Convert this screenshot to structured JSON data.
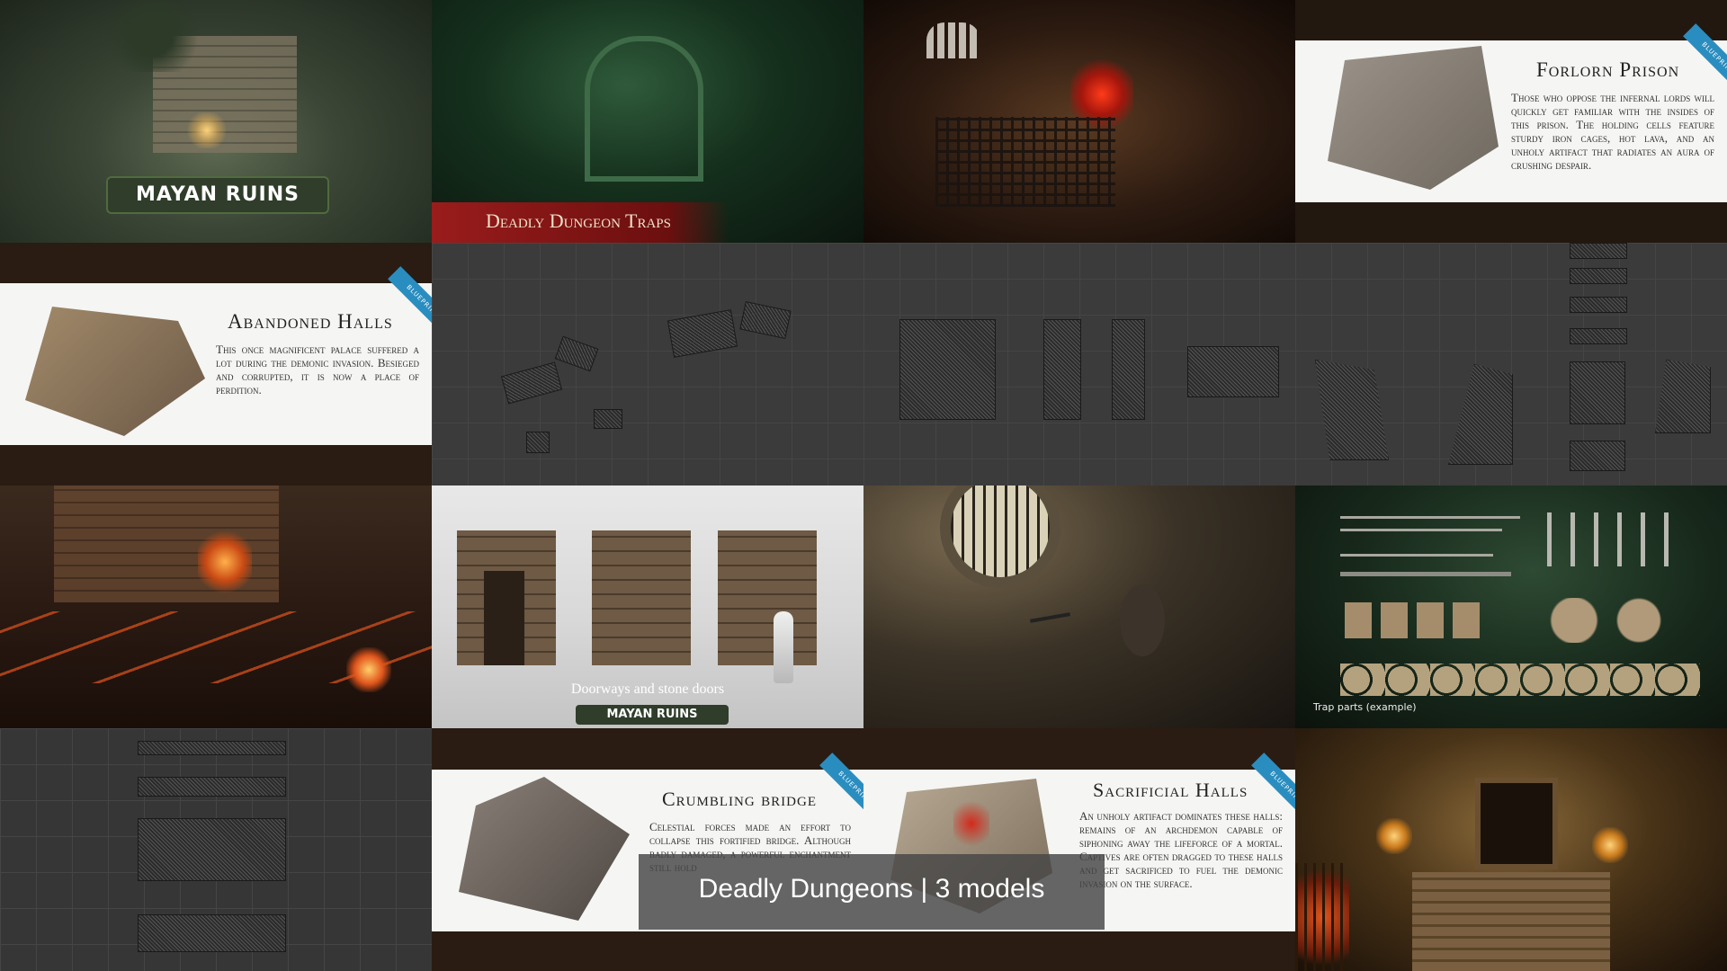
{
  "tiles": {
    "mayan_logo": "MAYAN RUINS",
    "traps_banner": "Deadly Dungeon Traps",
    "doorways_caption": "Doorways and stone doors",
    "doorways_logo": "MAYAN RUINS",
    "trap_parts_caption": "Trap parts (example)"
  },
  "cards": {
    "ribbon": "BLUEPRINT",
    "forlorn": {
      "title": "Forlorn Prison",
      "text": "Those who oppose the infernal lords will quickly get familiar with the insides of this prison. The holding cells feature sturdy iron cages, hot lava, and an unholy artifact that radiates an aura of crushing despair."
    },
    "abandoned": {
      "title": "Abandoned Halls",
      "text": "This once magnificent palace suffered a lot during the demonic invasion. Besieged and corrupted, it is now a place of perdition."
    },
    "crumbling": {
      "title": "Crumbling bridge",
      "text": "Celestial forces made an effort to collapse this fortified bridge. Although badly damaged, a powerful enchantment still hold"
    },
    "sacrificial": {
      "title": "Sacrificial Halls",
      "text": "An unholy artifact dominates these halls: remains of an archdemon capable of siphoning away the lifeforce of a mortal. Captives are often dragged to these halls and get sacrificed to fuel the demonic invasion on the surface."
    }
  },
  "overlay": {
    "title": "Deadly Dungeons | 3 models"
  },
  "colors": {
    "blueprint": "#2a8dc0",
    "lava": "#e0541c",
    "bg": "#1b1b1b"
  }
}
